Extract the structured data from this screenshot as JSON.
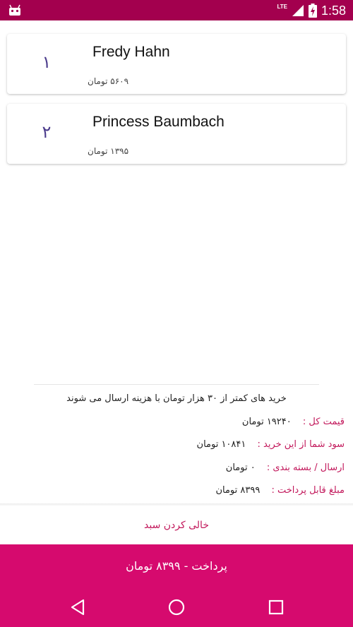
{
  "status_bar": {
    "time": "1:58",
    "network": "LTE",
    "app_icon": "android-icon",
    "signal_icon": "signal-icon",
    "battery_icon": "battery-charging-icon"
  },
  "items": [
    {
      "index": "۱",
      "name": "Fredy Hahn",
      "price": "۵۶۰۹ تومان"
    },
    {
      "index": "۲",
      "name": "Princess Baumbach",
      "price": "۱۳۹۵ تومان"
    }
  ],
  "summary": {
    "notice": "خرید های کمتر از ۳۰ هزار تومان با هزینه ارسال می شوند",
    "rows": [
      {
        "label": "قیمت کل :",
        "value": "۱۹۲۴۰ تومان"
      },
      {
        "label": "سود شما از این خرید :",
        "value": "۱۰۸۴۱ تومان"
      },
      {
        "label": "ارسال / بسته بندی :",
        "value": "۰ تومان"
      },
      {
        "label": "مبلغ قابل پرداخت :",
        "value": "۸۳۹۹ تومان"
      }
    ]
  },
  "actions": {
    "clear_cart": "خالی کردن سبد",
    "pay": "پرداخت - ۸۳۹۹ تومان"
  },
  "colors": {
    "status_bar": "#a3004e",
    "accent": "#d60a6e",
    "label": "#c2185b",
    "number": "#4b3c8c"
  }
}
